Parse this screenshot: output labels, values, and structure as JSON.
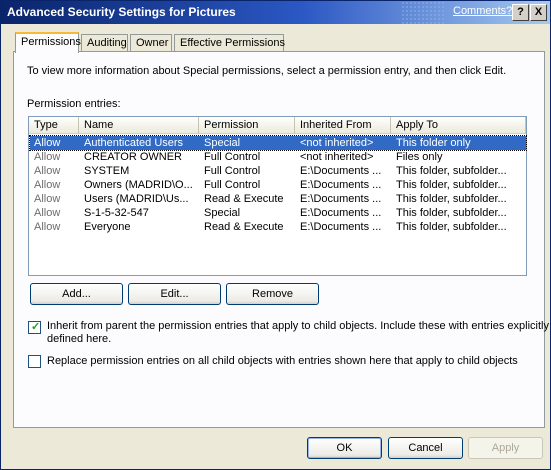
{
  "window": {
    "title": "Advanced Security Settings for Pictures",
    "help_link": "Comments?",
    "help_button": "?",
    "close_button": "X"
  },
  "tabs": [
    {
      "label": "Permissions",
      "active": true
    },
    {
      "label": "Auditing"
    },
    {
      "label": "Owner"
    },
    {
      "label": "Effective Permissions"
    }
  ],
  "info_text": "To view more information about Special permissions, select a permission entry, and then click Edit.",
  "entries_label": "Permission entries:",
  "columns": [
    "Type",
    "Name",
    "Permission",
    "Inherited From",
    "Apply To"
  ],
  "rows": [
    [
      "Allow",
      "Authenticated Users",
      "Special",
      "<not inherited>",
      "This folder only"
    ],
    [
      "Allow",
      "CREATOR OWNER",
      "Full Control",
      "<not inherited>",
      "Files only"
    ],
    [
      "Allow",
      "SYSTEM",
      "Full Control",
      "E:\\Documents ...",
      "This folder, subfolder..."
    ],
    [
      "Allow",
      "Owners (MADRID\\O...",
      "Full Control",
      "E:\\Documents ...",
      "This folder, subfolder..."
    ],
    [
      "Allow",
      "Users (MADRID\\Us...",
      "Read & Execute",
      "E:\\Documents ...",
      "This folder, subfolder..."
    ],
    [
      "Allow",
      "S-1-5-32-547",
      "Special",
      "E:\\Documents ...",
      "This folder, subfolder..."
    ],
    [
      "Allow",
      "Everyone",
      "Read & Execute",
      "E:\\Documents ...",
      "This folder, subfolder..."
    ]
  ],
  "buttons": {
    "add": "Add...",
    "edit": "Edit...",
    "remove": "Remove",
    "ok": "OK",
    "cancel": "Cancel",
    "apply": "Apply"
  },
  "checkboxes": {
    "inherit_line1": "Inherit from parent the permission entries that apply to child objects. Include these with entries explicitly",
    "inherit_line2": "defined here.",
    "inherit_checked": true,
    "replace": "Replace permission entries on all child objects with entries shown here that apply to child objects",
    "replace_checked": false
  },
  "colors": {
    "accent": "#316ac5",
    "titlebar": "#0a246a"
  }
}
